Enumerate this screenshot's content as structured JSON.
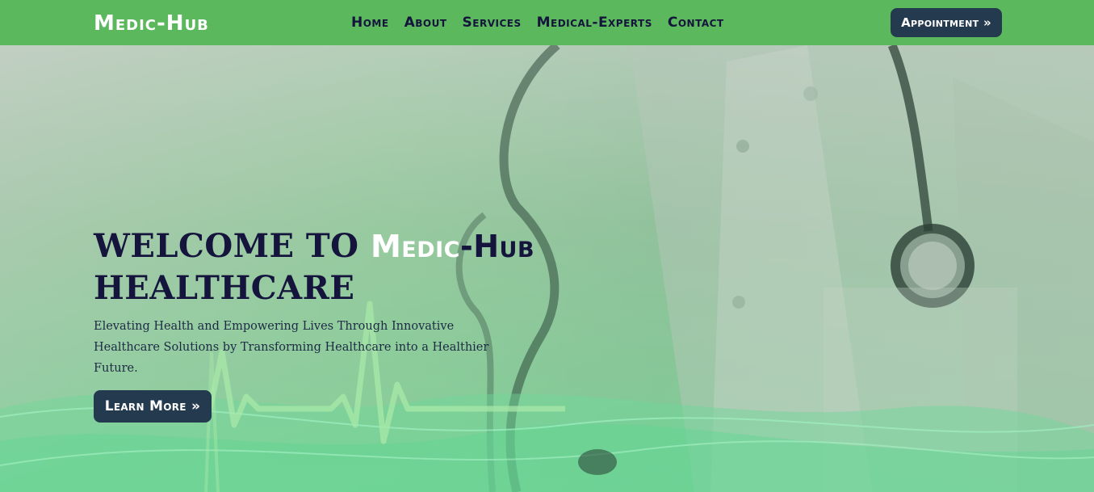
{
  "navbar": {
    "brand": "Medic-Hub",
    "links": [
      "Home",
      "About",
      "Services",
      "Medical-Experts",
      "Contact"
    ],
    "appointment_label": "Appointment »"
  },
  "hero": {
    "title_prefix": "WELCOME TO ",
    "brand_white": "Medic",
    "brand_dark": "-Hub",
    "title_suffix": "HEALTHCARE",
    "subtitle": "Elevating Health and Empowering Lives Through Innovative Healthcare Solutions by Transforming Healthcare into a Healthier Future.",
    "learn_more_label": "Learn More »"
  },
  "colors": {
    "nav_bg": "#5cb85c",
    "button_bg": "#243a4f",
    "title_color": "#14143c"
  }
}
